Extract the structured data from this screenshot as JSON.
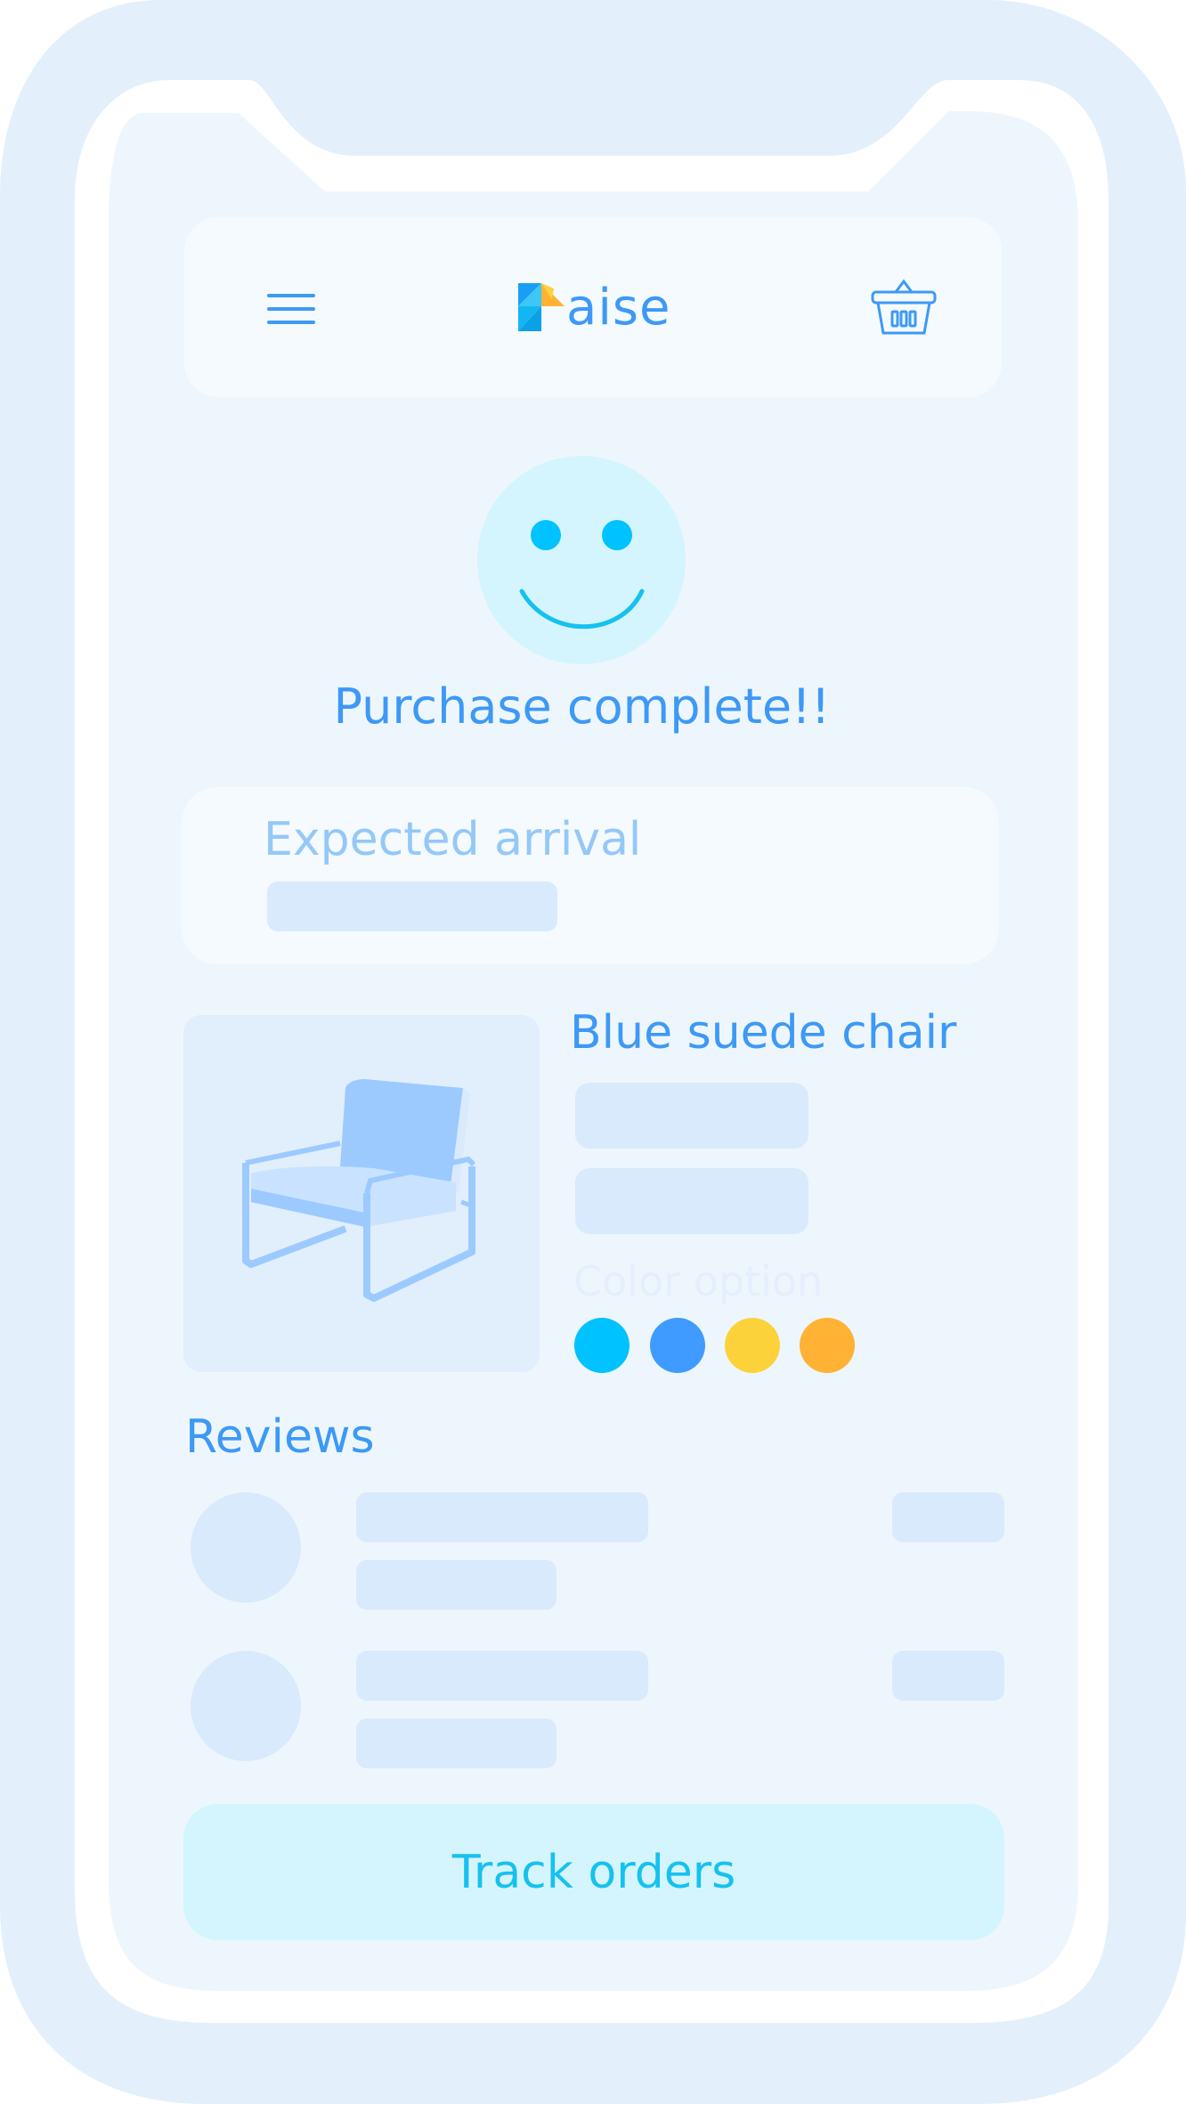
{
  "app": {
    "brand_suffix": "aise",
    "brand_icon": "paise-logo-icon"
  },
  "header": {
    "menu_icon": "hamburger-menu-icon",
    "cart_icon": "shopping-basket-icon"
  },
  "status": {
    "icon": "smiley-face-icon",
    "title": "Purchase complete!!"
  },
  "arrival": {
    "label": "Expected arrival"
  },
  "product": {
    "name": "Blue suede chair",
    "image": "armchair-illustration",
    "color_label": "Color option",
    "colors": [
      "#00c2ff",
      "#3f9bff",
      "#fcd23a",
      "#ffb233"
    ]
  },
  "reviews": {
    "title": "Reviews"
  },
  "cta": {
    "label": "Track orders"
  },
  "theme": {
    "accent": "#3d99f5",
    "cyan": "#16c1ef",
    "placeholder": "#d9eafc"
  }
}
